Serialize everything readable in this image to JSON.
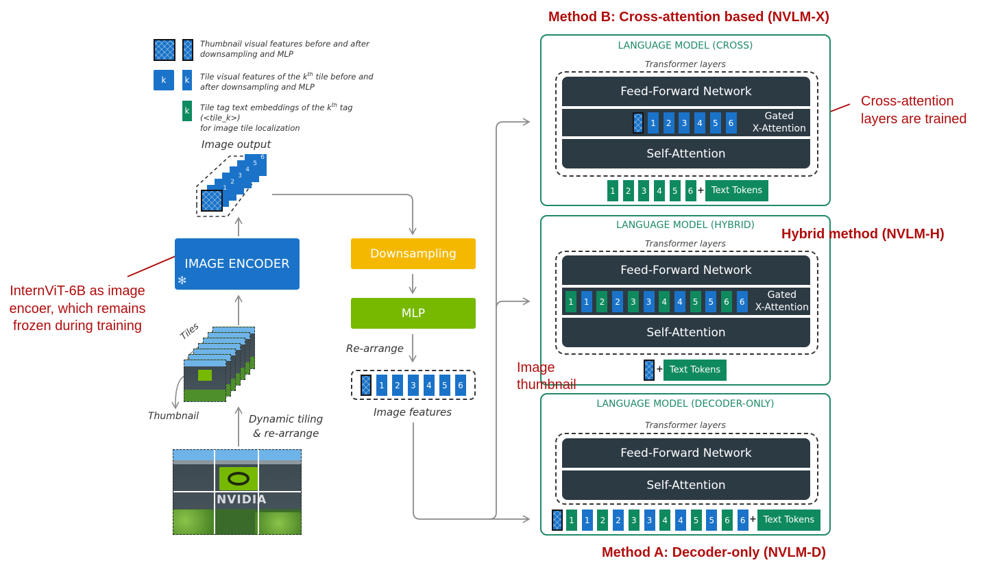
{
  "legend": {
    "items": [
      {
        "icon": "thumbnail-feature-icon",
        "text_line1": "Thumbnail visual features before and after",
        "text_line2": "downsampling and MLP"
      },
      {
        "icon": "tile-feature-icon",
        "symbol": "k",
        "text_line1": "Tile visual features of the k",
        "sup": "th",
        "text_line1_end": " tile before and",
        "text_line2": "after downsampling and MLP"
      },
      {
        "icon": "tile-tag-icon",
        "symbol": "k",
        "text_line1": "Tile tag text embeddings of the k",
        "sup": "th",
        "text_line1_end": " tag (<tile_k>)",
        "text_line2": "for image tile localization"
      }
    ]
  },
  "encoder_path": {
    "image_output_label": "Image output",
    "image_output_stack_numbers": [
      "1",
      "2",
      "3",
      "4",
      "5",
      "6"
    ],
    "image_encoder_label": "IMAGE ENCODER",
    "frozen_icon": "snowflake-icon",
    "tiles_label": "Tiles",
    "thumbnail_label": "Thumbnail",
    "dynamic_tiling_line1": "Dynamic tiling",
    "dynamic_tiling_line2": "& re-arrange",
    "input_image_text": "NVIDIA"
  },
  "annotation_left": {
    "line1": "InternViT-6B as image",
    "line2": "encoer, which remains",
    "line3": "frozen during training"
  },
  "middle_path": {
    "downsampling_label": "Downsampling",
    "mlp_label": "MLP",
    "rearrange_label": "Re-arrange",
    "image_features_label": "Image features",
    "image_features_tokens": [
      "1",
      "2",
      "3",
      "4",
      "5",
      "6"
    ]
  },
  "method_b": {
    "heading": "Method B: Cross-attention based (NVLM-X)",
    "panel_title": "LANGUAGE MODEL (CROSS)",
    "transformer_label": "Transformer layers",
    "ffn_label": "Feed-Forward Network",
    "gated_line1": "Gated",
    "gated_line2": "X-Attention",
    "gated_tokens": [
      "1",
      "2",
      "3",
      "4",
      "5",
      "6"
    ],
    "self_attention_label": "Self-Attention",
    "input_tokens": [
      "1",
      "2",
      "3",
      "4",
      "5",
      "6"
    ],
    "plus": "+",
    "text_tokens_label": "Text Tokens",
    "annotation_line1": "Cross-attention",
    "annotation_line2": "layers are trained"
  },
  "method_h": {
    "heading": "Hybrid method (NVLM-H)",
    "panel_title": "LANGUAGE MODEL (HYBRID)",
    "transformer_label": "Transformer layers",
    "ffn_label": "Feed-Forward Network",
    "gated_line1": "Gated",
    "gated_line2": "X-Attention",
    "gated_tokens": [
      {
        "n": "1",
        "kind": "green"
      },
      {
        "n": "1",
        "kind": "blue"
      },
      {
        "n": "2",
        "kind": "green"
      },
      {
        "n": "2",
        "kind": "blue"
      },
      {
        "n": "3",
        "kind": "green"
      },
      {
        "n": "3",
        "kind": "blue"
      },
      {
        "n": "4",
        "kind": "green"
      },
      {
        "n": "4",
        "kind": "blue"
      },
      {
        "n": "5",
        "kind": "green"
      },
      {
        "n": "5",
        "kind": "blue"
      },
      {
        "n": "6",
        "kind": "green"
      },
      {
        "n": "6",
        "kind": "blue"
      }
    ],
    "self_attention_label": "Self-Attention",
    "plus": "+",
    "text_tokens_label": "Text Tokens",
    "annotation_line1": "Image",
    "annotation_line2": "thumbnail"
  },
  "method_a": {
    "heading": "Method A: Decoder-only (NVLM-D)",
    "panel_title": "LANGUAGE MODEL (DECODER-ONLY)",
    "transformer_label": "Transformer layers",
    "ffn_label": "Feed-Forward Network",
    "self_attention_label": "Self-Attention",
    "input_tokens": [
      {
        "n": "1",
        "kind": "green"
      },
      {
        "n": "1",
        "kind": "blue"
      },
      {
        "n": "2",
        "kind": "green"
      },
      {
        "n": "2",
        "kind": "blue"
      },
      {
        "n": "3",
        "kind": "green"
      },
      {
        "n": "3",
        "kind": "blue"
      },
      {
        "n": "4",
        "kind": "green"
      },
      {
        "n": "4",
        "kind": "blue"
      },
      {
        "n": "5",
        "kind": "green"
      },
      {
        "n": "5",
        "kind": "blue"
      },
      {
        "n": "6",
        "kind": "green"
      },
      {
        "n": "6",
        "kind": "blue"
      }
    ],
    "plus": "+",
    "text_tokens_label": "Text Tokens"
  },
  "colors": {
    "annotation_red": "#b00d0d",
    "panel_green": "#1e8a64",
    "token_blue": "#1a73c8",
    "token_green": "#0f8a5f",
    "layer_dark": "#2c3a44",
    "downsampling_yellow": "#f5b800",
    "mlp_green": "#76b900",
    "encoder_blue": "#1a73c8"
  }
}
